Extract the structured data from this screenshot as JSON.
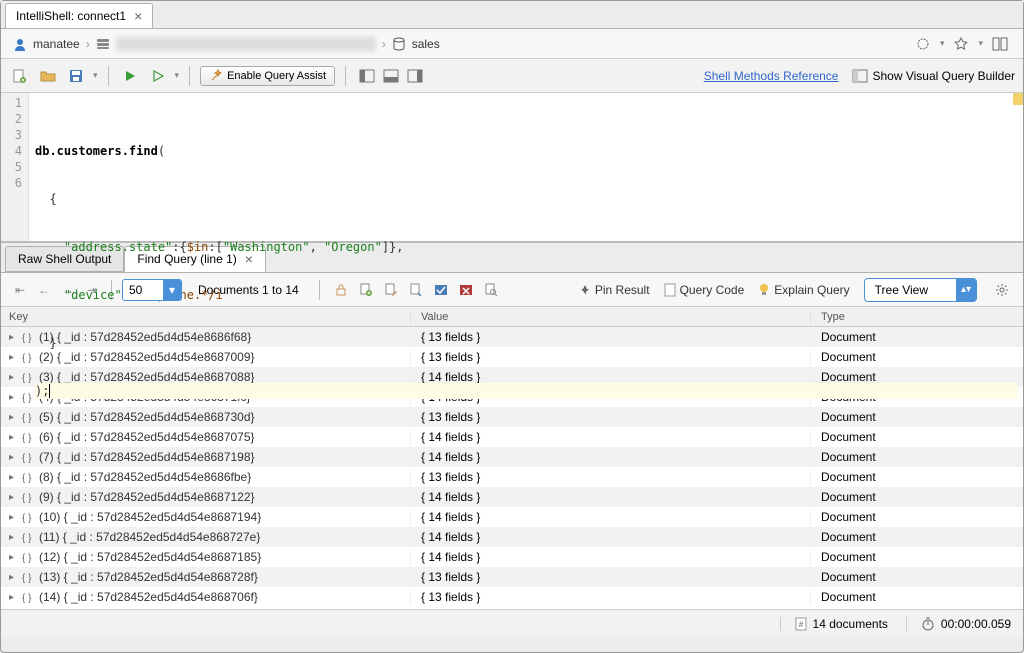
{
  "tab": {
    "title": "IntelliShell: connect1"
  },
  "breadcrumb": {
    "user": "manatee",
    "db": "sales"
  },
  "toolbar": {
    "enable_assist": "Enable Query Assist",
    "shell_methods": "Shell Methods Reference",
    "visual_qb": "Show Visual Query Builder"
  },
  "editor": {
    "lines": [
      "1",
      "2",
      "3",
      "4",
      "5",
      "6"
    ],
    "code": {
      "l1_a": "db.customers.find",
      "l1_b": "(",
      "l2": "  {",
      "l3_a": "    ",
      "l3_key": "\"address.state\"",
      "l3_b": ":{",
      "l3_op": "$in",
      "l3_c": ":[",
      "l3_s1": "\"Washington\"",
      "l3_d": ", ",
      "l3_s2": "\"Oregon\"",
      "l3_e": "]},",
      "l4_a": "    ",
      "l4_key": "\"device\"",
      "l4_b": ":",
      "l4_re": "/.*iphone.*/i",
      "l5": "  }",
      "l6": ");"
    }
  },
  "result_tabs": {
    "raw": "Raw Shell Output",
    "find": "Find Query (line 1)"
  },
  "result_toolbar": {
    "page_size": "50",
    "doc_range": "Documents 1 to 14",
    "pin": "Pin Result",
    "query_code": "Query Code",
    "explain": "Explain Query",
    "view": "Tree View"
  },
  "grid": {
    "headers": {
      "key": "Key",
      "value": "Value",
      "type": "Type"
    },
    "rows": [
      {
        "idx": "(1)",
        "id": "{ _id : 57d28452ed5d4d54e8686f68}",
        "val": "{ 13 fields }",
        "type": "Document"
      },
      {
        "idx": "(2)",
        "id": "{ _id : 57d28452ed5d4d54e8687009}",
        "val": "{ 13 fields }",
        "type": "Document"
      },
      {
        "idx": "(3)",
        "id": "{ _id : 57d28452ed5d4d54e8687088}",
        "val": "{ 14 fields }",
        "type": "Document"
      },
      {
        "idx": "(4)",
        "id": "{ _id : 57d28452ed5d4d54e86871fc}",
        "val": "{ 14 fields }",
        "type": "Document"
      },
      {
        "idx": "(5)",
        "id": "{ _id : 57d28452ed5d4d54e868730d}",
        "val": "{ 13 fields }",
        "type": "Document"
      },
      {
        "idx": "(6)",
        "id": "{ _id : 57d28452ed5d4d54e8687075}",
        "val": "{ 14 fields }",
        "type": "Document"
      },
      {
        "idx": "(7)",
        "id": "{ _id : 57d28452ed5d4d54e8687198}",
        "val": "{ 14 fields }",
        "type": "Document"
      },
      {
        "idx": "(8)",
        "id": "{ _id : 57d28452ed5d4d54e8686fbe}",
        "val": "{ 13 fields }",
        "type": "Document"
      },
      {
        "idx": "(9)",
        "id": "{ _id : 57d28452ed5d4d54e8687122}",
        "val": "{ 14 fields }",
        "type": "Document"
      },
      {
        "idx": "(10)",
        "id": "{ _id : 57d28452ed5d4d54e8687194}",
        "val": "{ 14 fields }",
        "type": "Document"
      },
      {
        "idx": "(11)",
        "id": "{ _id : 57d28452ed5d4d54e868727e}",
        "val": "{ 14 fields }",
        "type": "Document"
      },
      {
        "idx": "(12)",
        "id": "{ _id : 57d28452ed5d4d54e8687185}",
        "val": "{ 14 fields }",
        "type": "Document"
      },
      {
        "idx": "(13)",
        "id": "{ _id : 57d28452ed5d4d54e868728f}",
        "val": "{ 13 fields }",
        "type": "Document"
      },
      {
        "idx": "(14)",
        "id": "{ _id : 57d28452ed5d4d54e868706f}",
        "val": "{ 13 fields }",
        "type": "Document"
      }
    ]
  },
  "status": {
    "count": "14 documents",
    "time": "00:00:00.059"
  }
}
